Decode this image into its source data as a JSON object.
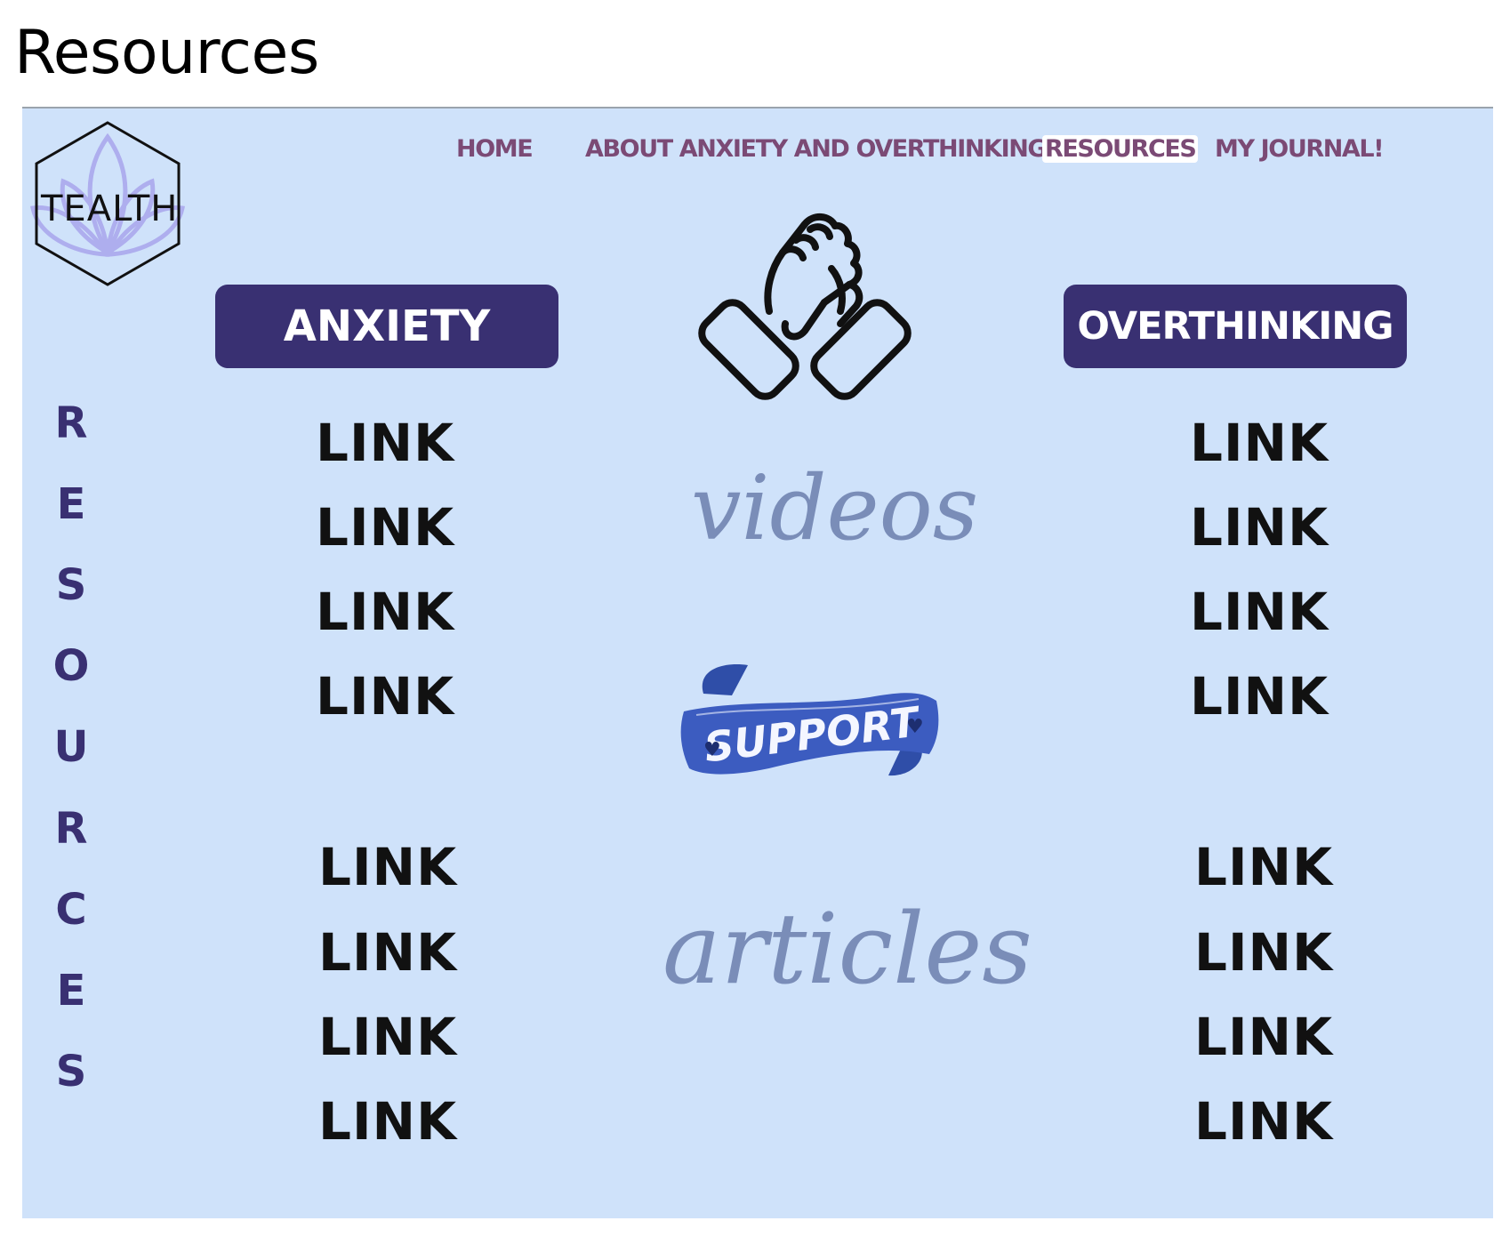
{
  "slide": {
    "title": "Resources"
  },
  "logo": {
    "text": "TEALTH"
  },
  "nav": {
    "home": "HOME",
    "about": "ABOUT ANXIETY AND OVERTHINKING",
    "resources": "RESOURCES",
    "journal": "MY JOURNAL!",
    "active": "RESOURCES"
  },
  "side_heading": {
    "letters": [
      "R",
      "E",
      "S",
      "O",
      "U",
      "R",
      "C",
      "E",
      "S"
    ]
  },
  "anxiety": {
    "title": "ANXIETY",
    "links": [
      "LINK",
      "LINK",
      "LINK",
      "LINK",
      "LINK",
      "LINK",
      "LINK",
      "LINK"
    ]
  },
  "overthinking": {
    "title": "OVERTHINKING",
    "links": [
      "LINK",
      "LINK",
      "LINK",
      "LINK",
      "LINK",
      "LINK",
      "LINK",
      "LINK"
    ]
  },
  "center": {
    "videos_label": "videos",
    "support_label": "SUPPORT",
    "articles_label": "articles"
  },
  "colors": {
    "panel_bg": "#cfe2fa",
    "pill_bg": "#393072",
    "nav_text": "#7b4a75",
    "script_text": "#7a8db8",
    "ribbon": "#3c5cc0",
    "logo_lotus": "#b7b4f0"
  },
  "icons": {
    "logo": "lotus-hexagon-icon",
    "center": "handshake-icon",
    "banner": "ribbon-banner-icon"
  }
}
